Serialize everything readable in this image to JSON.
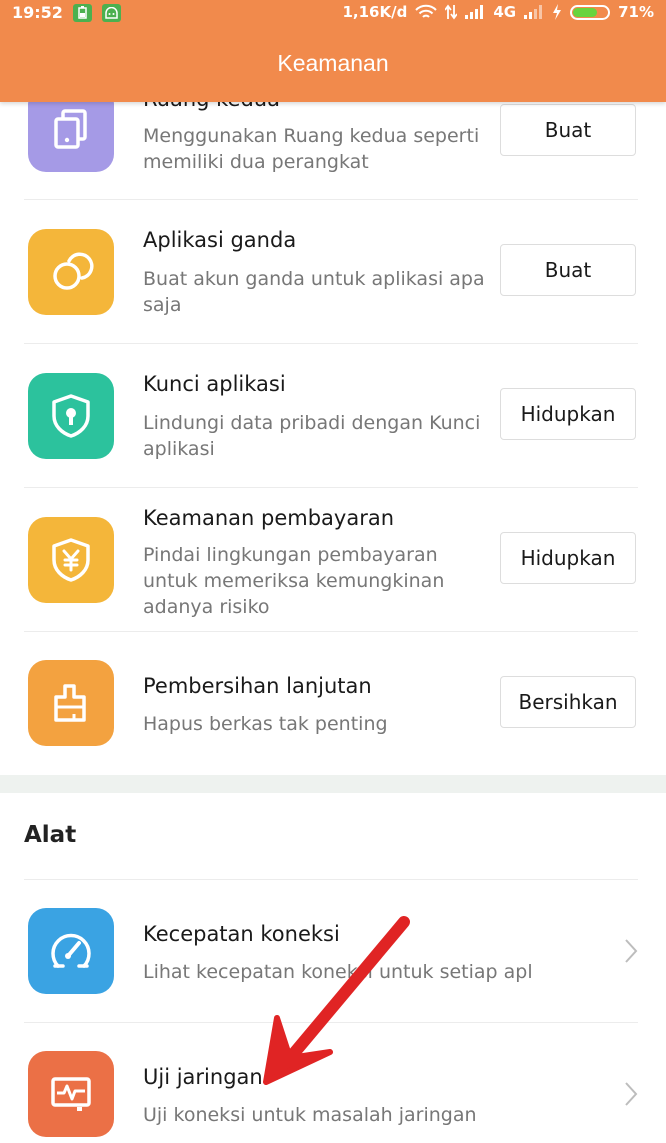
{
  "statusbar": {
    "time": "19:52",
    "speed": "1,16K/d",
    "network": "4G",
    "battery_percent": "71%",
    "battery_level": 0.71
  },
  "appbar": {
    "title": "Keamanan"
  },
  "features": [
    {
      "title": "Ruang kedua",
      "desc": "Menggunakan Ruang kedua seperti memiliki dua perangkat",
      "button": "Buat",
      "icon": "dual-screen-icon",
      "color": "#A59AE6"
    },
    {
      "title": "Aplikasi ganda",
      "desc": "Buat akun ganda untuk aplikasi apa saja",
      "button": "Buat",
      "icon": "dual-app-icon",
      "color": "#F4B63A"
    },
    {
      "title": "Kunci aplikasi",
      "desc": "Lindungi data pribadi dengan Kunci aplikasi",
      "button": "Hidupkan",
      "icon": "shield-lock-icon",
      "color": "#2CC29D"
    },
    {
      "title": "Keamanan pembayaran",
      "desc": "Pindai lingkungan pembayaran untuk memeriksa kemungkinan adanya risiko",
      "button": "Hidupkan",
      "icon": "shield-yen-icon",
      "color": "#F4B63A"
    },
    {
      "title": "Pembersihan lanjutan",
      "desc": "Hapus berkas tak penting",
      "button": "Bersihkan",
      "icon": "broom-icon",
      "color": "#F3A240"
    }
  ],
  "tools_section": {
    "title": "Alat",
    "items": [
      {
        "title": "Kecepatan koneksi",
        "desc": "Lihat kecepatan koneksi untuk setiap apl",
        "icon": "speedometer-icon",
        "color": "#3AA3E3"
      },
      {
        "title": "Uji jaringan",
        "desc": "Uji koneksi untuk masalah jaringan",
        "icon": "network-monitor-icon",
        "color": "#EB7046"
      }
    ]
  },
  "annotation": {
    "arrow_color": "#E02424",
    "icon": "red-arrow-annotation"
  }
}
